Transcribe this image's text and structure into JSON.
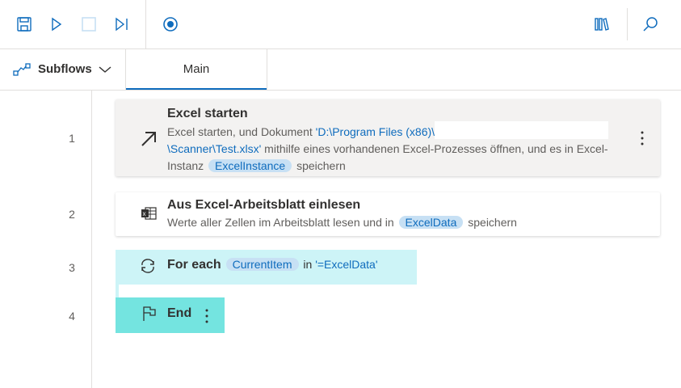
{
  "toolbar": {
    "buttons": [
      "save",
      "run",
      "stop",
      "next-action",
      "record"
    ],
    "right": [
      "variables",
      "search"
    ]
  },
  "tabs": {
    "subflows": "Subflows",
    "main": "Main"
  },
  "steps": [
    {
      "num": "1",
      "title": "Excel starten",
      "d1": "Excel starten, und Dokument ",
      "path1": "'D:\\Program Files (x86)\\",
      "path2": "\\Scanner\\Test.xlsx'",
      "d2": " mithilfe eines vorhandenen Excel-Prozesses öffnen, und es in Excel-",
      "d3": "Instanz ",
      "var": "ExcelInstance",
      "d4": " speichern"
    },
    {
      "num": "2",
      "title": "Aus Excel-Arbeitsblatt einlesen",
      "d1": "Werte aller Zellen im Arbeitsblatt lesen und in ",
      "var": "ExcelData",
      "d2": " speichern"
    },
    {
      "num": "3",
      "title": "For each",
      "var": "CurrentItem",
      "in": " in ",
      "expr": "'=ExcelData'"
    },
    {
      "num": "4",
      "title": "End"
    }
  ],
  "colors": {
    "accent": "#0f6cbd",
    "loop": "#cdf4f7",
    "end": "#74e4e0"
  }
}
